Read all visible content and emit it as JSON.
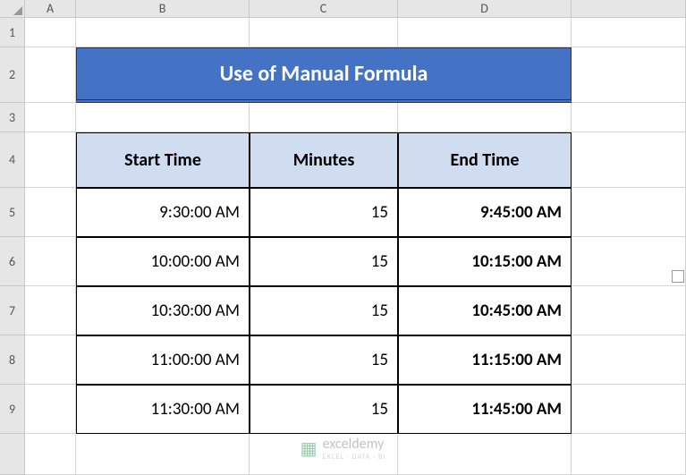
{
  "columns": [
    "A",
    "B",
    "C",
    "D"
  ],
  "rows": [
    "1",
    "2",
    "3",
    "4",
    "5",
    "6",
    "7",
    "8",
    "9"
  ],
  "title": "Use of Manual Formula",
  "headers": {
    "start_time": "Start Time",
    "minutes": "Minutes",
    "end_time": "End Time"
  },
  "data_rows": [
    {
      "start": "9:30:00 AM",
      "minutes": "15",
      "end": "9:45:00 AM"
    },
    {
      "start": "10:00:00 AM",
      "minutes": "15",
      "end": "10:15:00 AM"
    },
    {
      "start": "10:30:00 AM",
      "minutes": "15",
      "end": "10:45:00 AM"
    },
    {
      "start": "11:00:00 AM",
      "minutes": "15",
      "end": "11:15:00 AM"
    },
    {
      "start": "11:30:00 AM",
      "minutes": "15",
      "end": "11:45:00 AM"
    }
  ],
  "watermark": {
    "text": "exceldemy",
    "sub": "EXCEL · DATA · BI"
  }
}
